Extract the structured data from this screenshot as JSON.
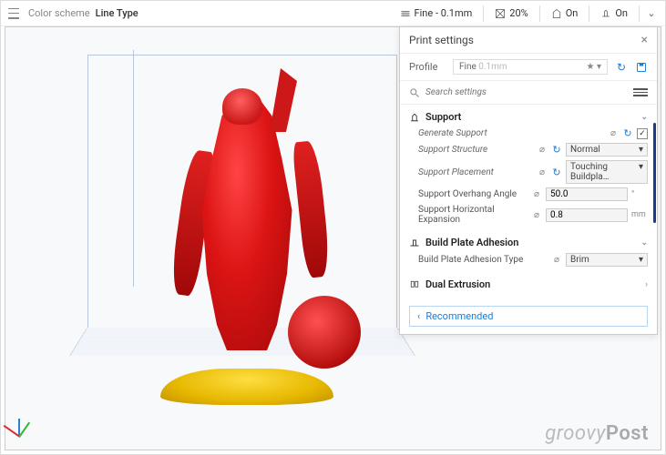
{
  "topbar": {
    "colorSchemeLabel": "Color scheme",
    "colorSchemeValue": "Line Type",
    "layerHeight": "Fine - 0.1mm",
    "infill": "20%",
    "support": "On",
    "adhesion": "On"
  },
  "panel": {
    "title": "Print settings",
    "profileLabel": "Profile",
    "profileValue": "Fine",
    "profileHint": "0.1mm",
    "searchPlaceholder": "Search settings",
    "sections": {
      "support": {
        "title": "Support",
        "rows": {
          "generate": {
            "label": "Generate Support",
            "checked": "✓"
          },
          "structure": {
            "label": "Support Structure",
            "value": "Normal"
          },
          "placement": {
            "label": "Support Placement",
            "value": "Touching Buildpla…"
          },
          "overhang": {
            "label": "Support Overhang Angle",
            "value": "50.0",
            "unit": "°"
          },
          "horizExp": {
            "label": "Support Horizontal Expansion",
            "value": "0.8",
            "unit": "mm"
          }
        }
      },
      "adhesion": {
        "title": "Build Plate Adhesion",
        "rows": {
          "type": {
            "label": "Build Plate Adhesion Type",
            "value": "Brim"
          }
        }
      },
      "dual": {
        "title": "Dual Extrusion"
      }
    },
    "recommended": "Recommended"
  },
  "watermark": {
    "a": "groovy",
    "b": "Post"
  }
}
